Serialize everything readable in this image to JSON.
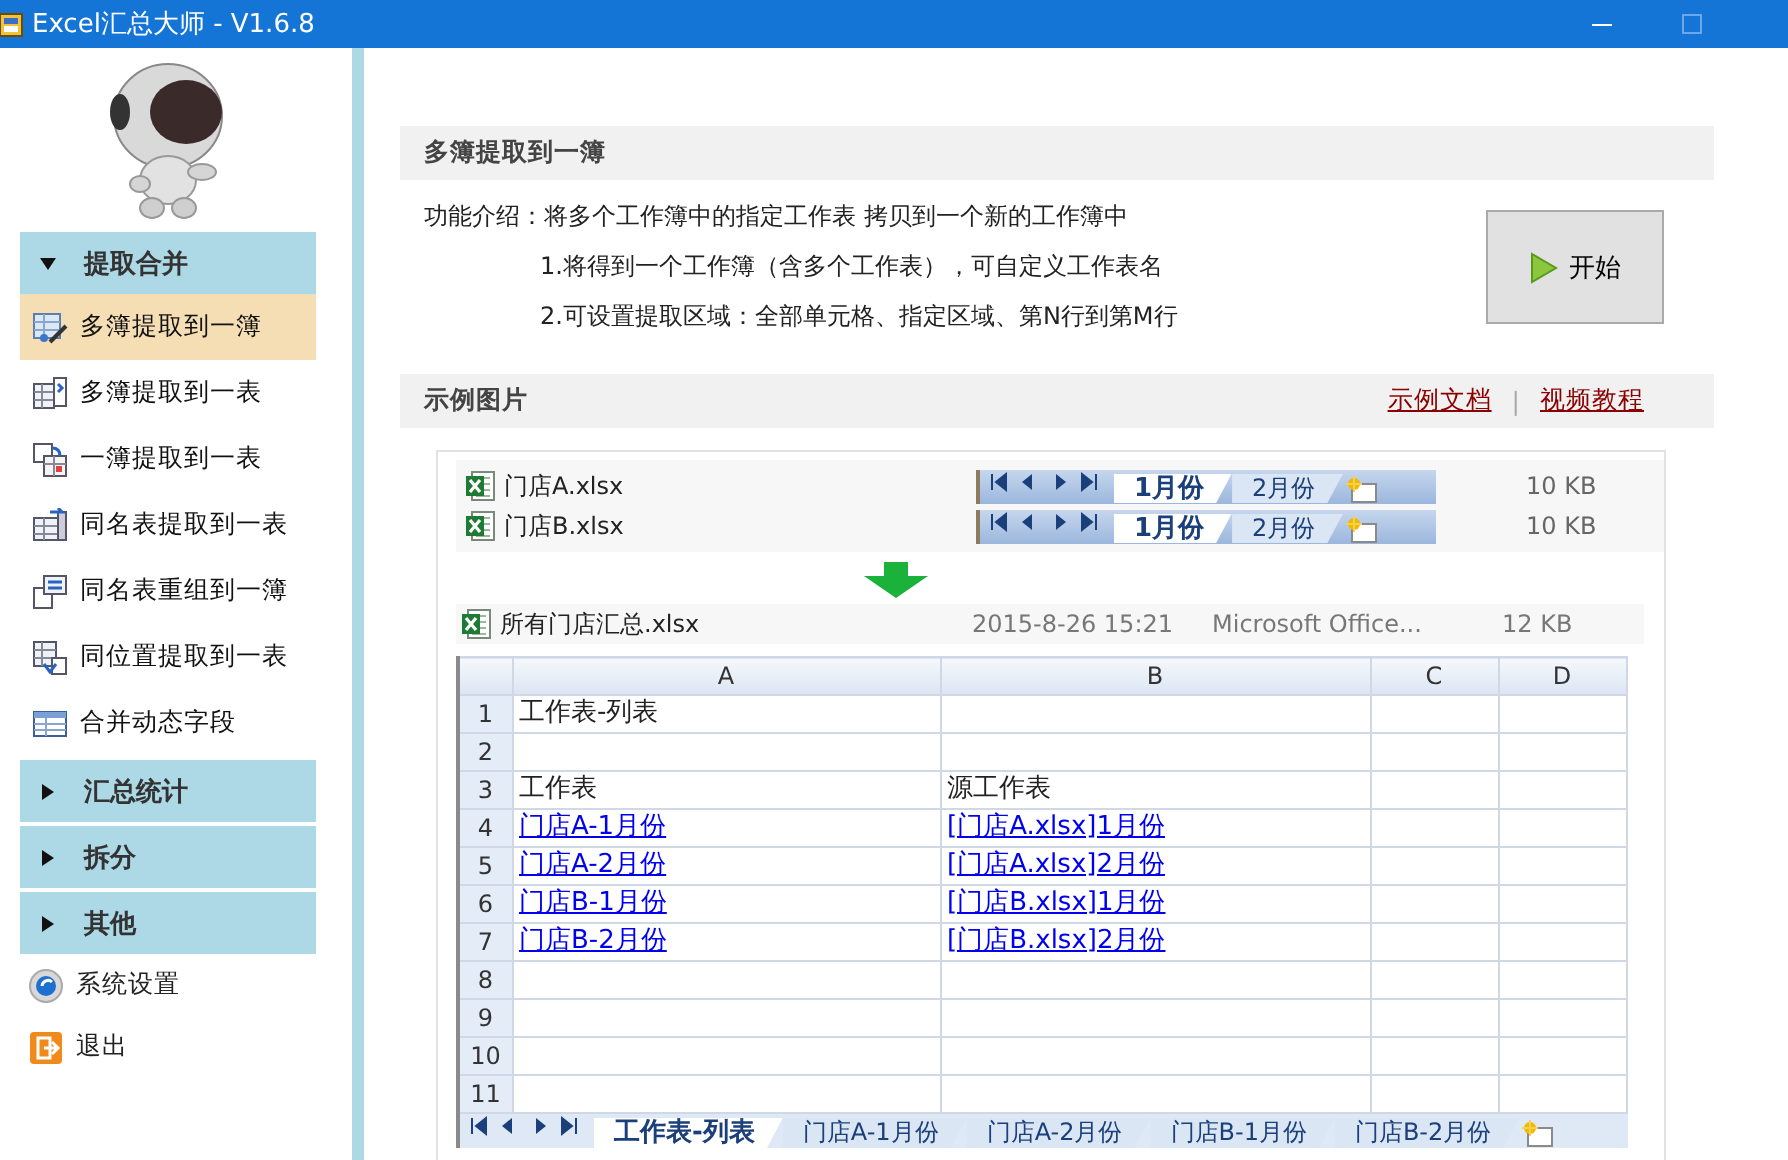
{
  "window": {
    "title": "Excel汇总大师 - V1.6.8"
  },
  "sidebar": {
    "groups": [
      {
        "label": "提取合并",
        "expanded": true,
        "items": [
          {
            "label": "多簿提取到一簿",
            "selected": true
          },
          {
            "label": "多簿提取到一表",
            "selected": false
          },
          {
            "label": "一簿提取到一表",
            "selected": false
          },
          {
            "label": "同名表提取到一表",
            "selected": false
          },
          {
            "label": "同名表重组到一簿",
            "selected": false
          },
          {
            "label": "同位置提取到一表",
            "selected": false
          },
          {
            "label": "合并动态字段",
            "selected": false
          }
        ]
      },
      {
        "label": "汇总统计",
        "expanded": false
      },
      {
        "label": "拆分",
        "expanded": false
      },
      {
        "label": "其他",
        "expanded": false
      }
    ],
    "footer_items": [
      {
        "label": "系统设置",
        "kind": "settings"
      },
      {
        "label": "退出",
        "kind": "exit"
      }
    ]
  },
  "main": {
    "title": "多簿提取到一簿",
    "intro": {
      "label": "功能介绍：",
      "text": "将多个工作簿中的指定工作表 拷贝到一个新的工作簿中",
      "points": [
        "1.将得到一个工作簿（含多个工作表），可自定义工作表名",
        "2.可设置提取区域：全部单元格、指定区域、第N行到第M行"
      ]
    },
    "start_button": "开始",
    "example": {
      "title": "示例图片",
      "links": [
        "示例文档",
        "视频教程"
      ],
      "link_separator": "|",
      "files": [
        {
          "name": "门店A.xlsx",
          "tabs": [
            {
              "label": "1月份",
              "selected": true
            },
            {
              "label": "2月份",
              "selected": false
            }
          ],
          "size": "10 KB"
        },
        {
          "name": "门店B.xlsx",
          "tabs": [
            {
              "label": "1月份",
              "selected": true
            },
            {
              "label": "2月份",
              "selected": false
            }
          ],
          "size": "10 KB"
        }
      ],
      "result_file": {
        "name": "所有门店汇总.xlsx",
        "date": "2015-8-26 15:21",
        "type": "Microsoft Office...",
        "size": "12 KB"
      },
      "sheet": {
        "columns": [
          "A",
          "B",
          "C",
          "D"
        ],
        "rows": [
          {
            "number": "1",
            "cells": [
              {
                "text": "工作表-列表",
                "link": false
              }
            ]
          },
          {
            "number": "2"
          },
          {
            "number": "3",
            "cells": [
              {
                "text": "工作表",
                "link": false
              },
              {
                "text": "源工作表",
                "link": false
              }
            ]
          },
          {
            "number": "4",
            "cells": [
              {
                "text": "门店A-1月份",
                "link": true
              },
              {
                "text": "[门店A.xlsx]1月份",
                "link": true
              }
            ]
          },
          {
            "number": "5",
            "cells": [
              {
                "text": "门店A-2月份",
                "link": true
              },
              {
                "text": "[门店A.xlsx]2月份",
                "link": true
              }
            ]
          },
          {
            "number": "6",
            "cells": [
              {
                "text": "门店B-1月份",
                "link": true
              },
              {
                "text": "[门店B.xlsx]1月份",
                "link": true
              }
            ]
          },
          {
            "number": "7",
            "cells": [
              {
                "text": "门店B-2月份",
                "link": true
              },
              {
                "text": "[门店B.xlsx]2月份",
                "link": true
              }
            ]
          },
          {
            "number": "8"
          },
          {
            "number": "9"
          },
          {
            "number": "10"
          },
          {
            "number": "11"
          }
        ],
        "tabs": [
          {
            "label": "工作表-列表",
            "selected": true
          },
          {
            "label": "门店A-1月份",
            "selected": false
          },
          {
            "label": "门店A-2月份",
            "selected": false
          },
          {
            "label": "门店B-1月份",
            "selected": false
          },
          {
            "label": "门店B-2月份",
            "selected": false
          }
        ]
      }
    }
  }
}
